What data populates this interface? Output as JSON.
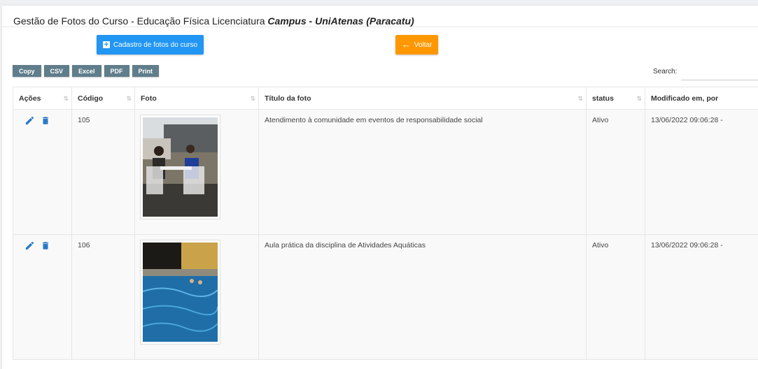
{
  "header": {
    "title": "Gestão de Fotos do Curso - Educação Física Licenciatura",
    "campus": "Campus - UniAtenas (Paracatu)"
  },
  "toolbar": {
    "add_label": "Cadastro de fotos do curso",
    "back_label": "Voltar",
    "export_buttons": [
      "Copy",
      "CSV",
      "Excel",
      "PDF",
      "Print"
    ],
    "search_label": "Search:",
    "search_value": ""
  },
  "table": {
    "columns": [
      "Ações",
      "Código",
      "Foto",
      "Título da foto",
      "status",
      "Modificado em, por"
    ],
    "rows": [
      {
        "codigo": "105",
        "titulo": "Atendimento à comunidade em eventos de responsabilidade social",
        "status": "Ativo",
        "modificado": "13/06/2022 09:06:28 -"
      },
      {
        "codigo": "106",
        "titulo": "Aula prática da disciplina de Atividades Aquáticas",
        "status": "Ativo",
        "modificado": "13/06/2022 09:06:28 -"
      }
    ]
  },
  "colors": {
    "primary": "#2196f3",
    "warning": "#ff9800",
    "export": "#607d8b",
    "action_icon": "#2a78c8"
  },
  "icons": [
    "plus-square-icon",
    "arrow-left-icon",
    "edit-pencil-icon",
    "trash-icon",
    "sort-icon"
  ]
}
